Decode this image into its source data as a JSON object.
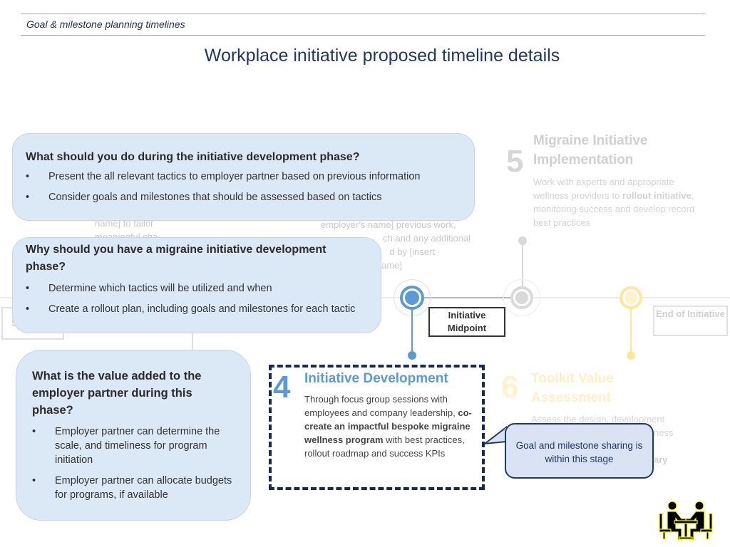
{
  "header": {
    "subtitle": "Goal & milestone planning timelines",
    "title": "Workplace initiative proposed timeline details"
  },
  "steps": {
    "step4": {
      "number": "4",
      "title": "Initiative Development",
      "body_pre": "Through focus group sessions with employees and company leadership, ",
      "body_bold": "co-create an impactful bespoke migraine wellness program",
      "body_post": " with best practices, rollout roadmap and success KPIs"
    },
    "step5": {
      "number": "5",
      "title": "Migraine Initiative Implementation",
      "body_pre": "Work with experts and appropriate wellness providers to ",
      "body_bold": "rollout initiative",
      "body_post": ", monitoring success and develop record best practices"
    },
    "step6": {
      "number": "6",
      "title": "Toolkit Value Assessment",
      "body_line1": "Assess the design, development",
      "body_line2": "ness",
      "body_line3": "ary"
    }
  },
  "background_fragments": {
    "frag_left_1": "name] to tailor",
    "frag_left_2": "meaningful cha",
    "frag_mid_1": "employer's name] previous work,",
    "frag_mid_2": "ch and any additional",
    "frag_mid_3": "d by  [insert",
    "frag_mid_4": "ame]"
  },
  "milestones": {
    "start_fragment": "S",
    "midpoint": "Initiative Midpoint",
    "end": "End of Initiative"
  },
  "callouts": {
    "what_to_do": {
      "heading": "What should you do during the initiative development phase?",
      "bullets": [
        "Present the all relevant tactics to employer partner based on previous information",
        "Consider goals and milestones that should be assessed based on tactics"
      ]
    },
    "why": {
      "heading": "Why should you have a migraine initiative development phase?",
      "bullets": [
        "Determine which tactics will be utilized and when",
        "Create a rollout plan, including goals and milestones for each tactic"
      ]
    },
    "value": {
      "heading": "What is the value added to the employer partner during this phase?",
      "bullets": [
        "Employer partner can determine the scale, and timeliness for program initiation",
        "Employer partner can allocate budgets for programs, if available"
      ]
    }
  },
  "speech_bubble": {
    "text": "Goal and milestone sharing is within this stage"
  },
  "icons": {
    "meeting": "meeting-icon"
  },
  "colors": {
    "accent_blue": "#5b9bd5",
    "navy": "#1f3864",
    "callout_fill": "#dbe8f5",
    "faded_gold": "#ffe699",
    "highlight_yellow": "#ffff00"
  }
}
